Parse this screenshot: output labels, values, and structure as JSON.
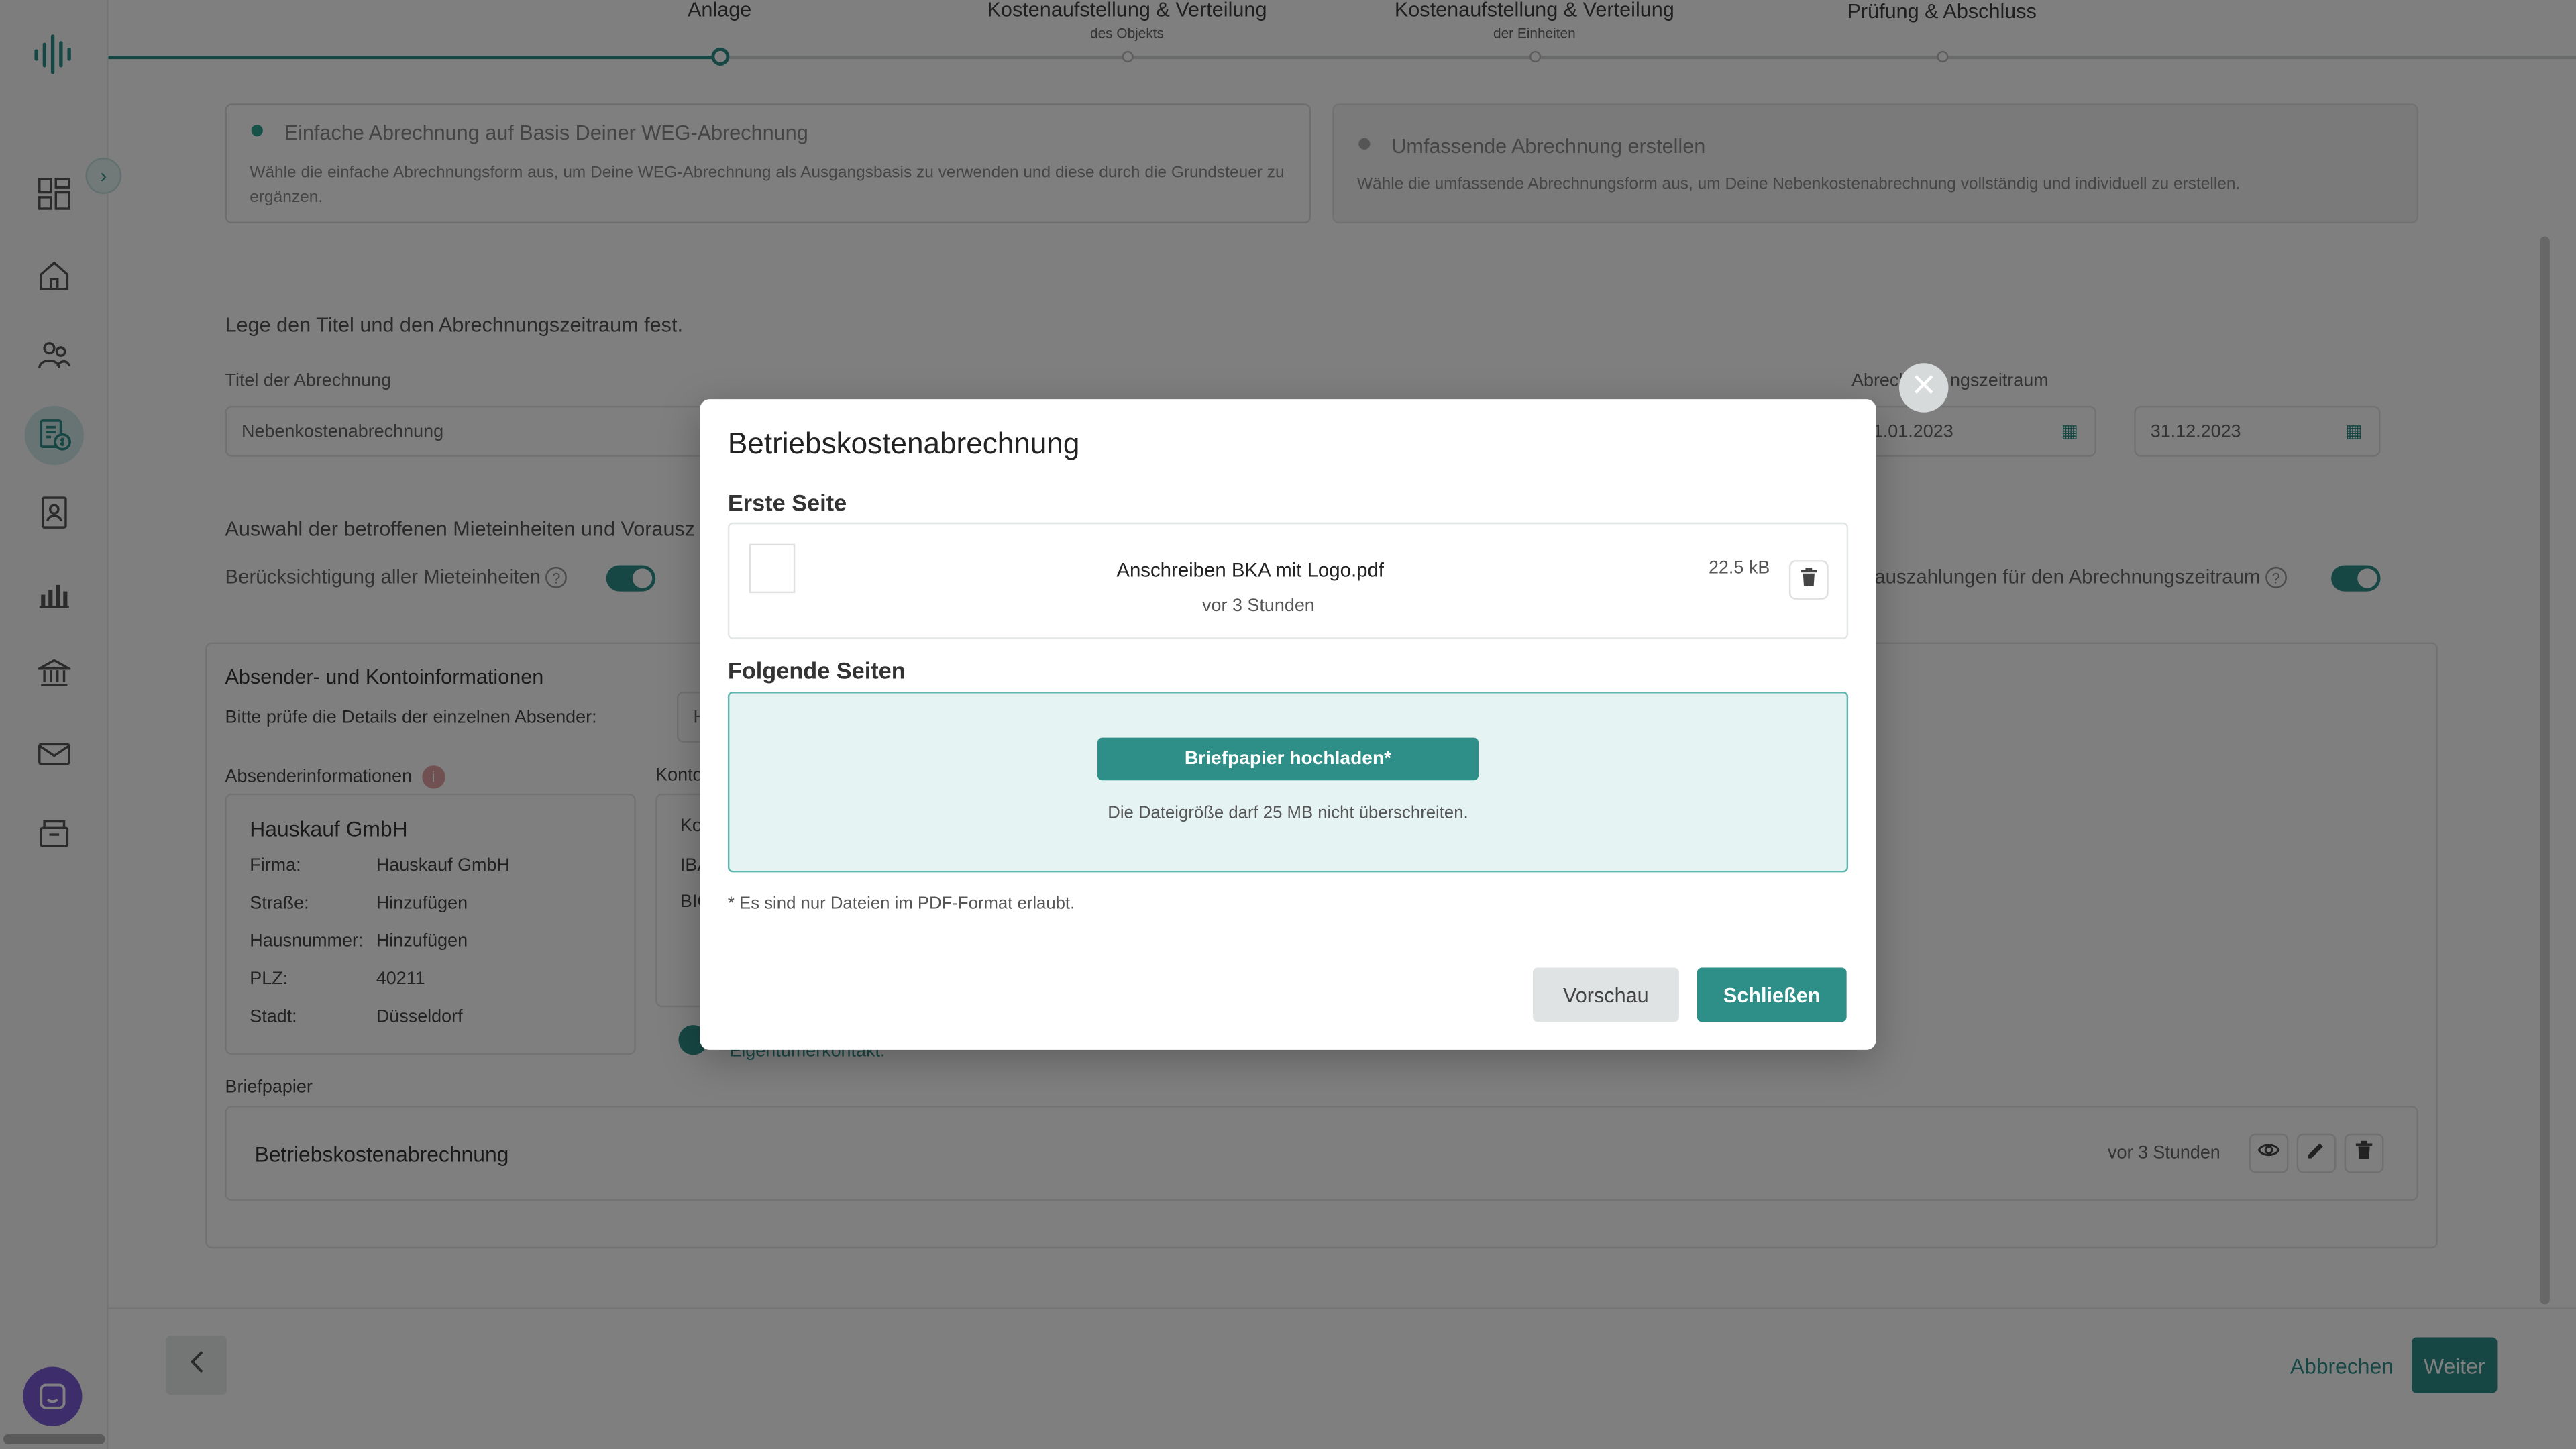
{
  "stepper": {
    "steps": [
      {
        "label": "Anlage",
        "sub": ""
      },
      {
        "label": "Kostenaufstellung & Verteilung",
        "sub": "des Objekts"
      },
      {
        "label": "Kostenaufstellung & Verteilung",
        "sub": "der Einheiten"
      },
      {
        "label": "Prüfung & Abschluss",
        "sub": ""
      }
    ]
  },
  "mode": {
    "simple": {
      "title": "Einfache Abrechnung auf Basis Deiner WEG-Abrechnung",
      "desc": "Wähle die einfache Abrechnungsform aus, um Deine WEG-Abrechnung als Ausgangsbasis zu verwenden und diese durch die Grundsteuer zu ergänzen."
    },
    "full": {
      "title": "Umfassende Abrechnung erstellen",
      "desc": "Wähle die umfassende Abrechnungsform aus, um Deine Nebenkostenabrechnung vollständig und individuell zu erstellen."
    }
  },
  "period": {
    "heading": "Lege den Titel und den Abrechnungszeitraum fest.",
    "title_label": "Titel der Abrechnung",
    "title_value": "Nebenkostenabrechnung",
    "period_label_partial": "Abrech",
    "period_label_tail": "ngszeitraum",
    "start_partial": "1.01.2023",
    "end": "31.12.2023"
  },
  "units": {
    "heading_partial": "Auswahl der betroffenen Mieteinheiten und Vorausz",
    "all_units": "Berücksichtigung aller Mieteinheiten",
    "prepay_partial": "auszahlungen für den Abrechnungszeitraum"
  },
  "sender": {
    "heading": "Absender- und Kontoinformationen",
    "check_hint": "Bitte prüfe die Details der einzelnen Absender:",
    "select_partial": "H",
    "info_label": "Absenderinformationen",
    "konto_partial": "Konto",
    "company_title": "Hauskauf GmbH",
    "rows": [
      {
        "k": "Firma:",
        "v": "Hauskauf GmbH",
        "link": false
      },
      {
        "k": "Straße:",
        "v": "Hinzufügen",
        "link": true
      },
      {
        "k": "Hausnummer:",
        "v": "Hinzufügen",
        "link": true
      },
      {
        "k": "PLZ:",
        "v": "40211",
        "link": false
      },
      {
        "k": "Stadt:",
        "v": "Düsseldorf",
        "link": false
      }
    ],
    "konto_rows": [
      "Ko",
      "IBA",
      "BIC"
    ],
    "owner_contact_partial": "Eigentümerkontakt."
  },
  "letterhead": {
    "label": "Briefpapier",
    "name": "Betriebskostenabrechnung",
    "time": "vor 3 Stunden"
  },
  "footer": {
    "cancel": "Abbrechen",
    "next": "Weiter"
  },
  "modal": {
    "title": "Betriebskostenabrechnung",
    "first_page": "Erste Seite",
    "file_name": "Anschreiben BKA mit Logo.pdf",
    "file_time": "vor 3 Stunden",
    "file_size": "22.5 kB",
    "following_pages": "Folgende Seiten",
    "upload_label": "Briefpapier hochladen*",
    "size_hint": "Die Dateigröße darf 25 MB nicht überschreiten.",
    "pdf_note": "* Es sind nur Dateien im PDF-Format erlaubt.",
    "preview": "Vorschau",
    "close": "Schließen"
  },
  "colors": {
    "accent": "#2e8f89",
    "overlay": "rgba(0,0,0,0.50)"
  }
}
